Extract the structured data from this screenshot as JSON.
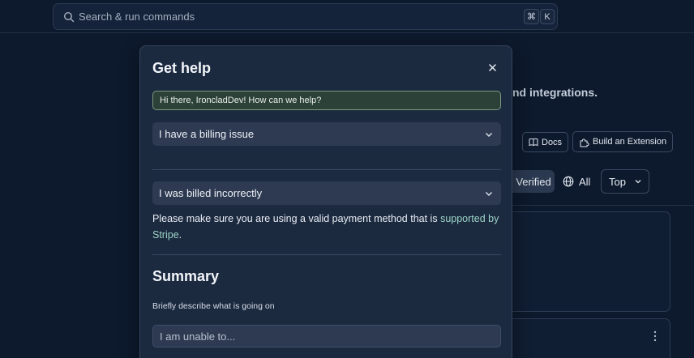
{
  "search": {
    "placeholder": "Search & run commands",
    "shortcut": [
      "⌘",
      "K"
    ]
  },
  "background": {
    "heading_fragment": "nd integrations.",
    "docs_button": "Docs",
    "build_extension_button": "Build an Extension",
    "filter_verified": "Verified",
    "filter_all": "All",
    "sort_label": "Top"
  },
  "modal": {
    "title": "Get help",
    "greeting": "Hi there, IroncladDev! How can we help?",
    "category_select": "I have a billing issue",
    "subcategory_select": "I was billed incorrectly",
    "note_text": "Please make sure you are using a valid payment method that is ",
    "note_link": "supported by Stripe",
    "note_end": ".",
    "summary_heading": "Summary",
    "summary_label": "Briefly describe what is going on",
    "summary_placeholder": "I am unable to..."
  }
}
